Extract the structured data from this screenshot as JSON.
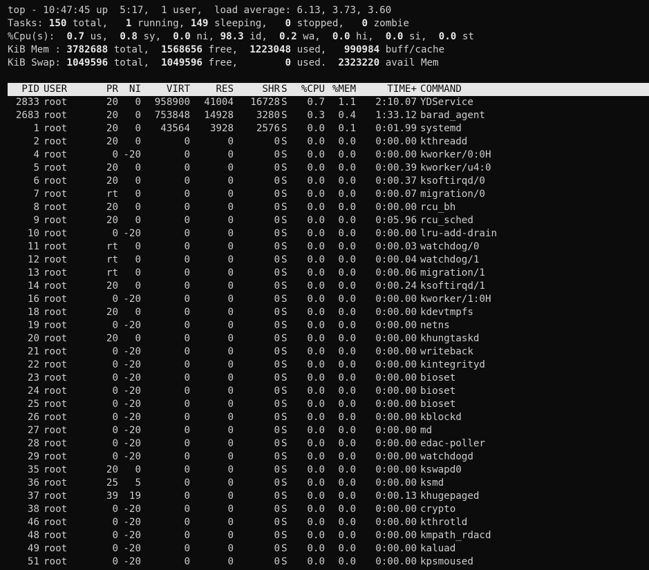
{
  "summary": {
    "line1": "top - 10:47:45 up  5:17,  1 user,  load average: 6.13, 3.73, 3.60",
    "tasks": {
      "label": "Tasks:",
      "total": "150",
      "total_l": " total,",
      "running": "1",
      "running_l": " running,",
      "sleeping": "149",
      "sleeping_l": " sleeping,",
      "stopped": "0",
      "stopped_l": " stopped,",
      "zombie": "0",
      "zombie_l": " zombie"
    },
    "cpu": {
      "label": "%Cpu(s):",
      "us": "0.7",
      "us_l": " us,",
      "sy": "0.8",
      "sy_l": " sy,",
      "ni": "0.0",
      "ni_l": " ni,",
      "id": "98.3",
      "id_l": " id,",
      "wa": "0.2",
      "wa_l": " wa,",
      "hi": "0.0",
      "hi_l": " hi,",
      "si": "0.0",
      "si_l": " si,",
      "st": "0.0",
      "st_l": " st"
    },
    "mem": {
      "label": "KiB Mem :",
      "total": "3782688",
      "total_l": " total,",
      "free": "1568656",
      "free_l": " free,",
      "used": "1223048",
      "used_l": " used,",
      "buff": "990984",
      "buff_l": " buff/cache"
    },
    "swap": {
      "label": "KiB Swap:",
      "total": "1049596",
      "total_l": " total,",
      "free": "1049596",
      "free_l": " free,",
      "used": "0",
      "used_l": " used.",
      "avail": "2323220",
      "avail_l": " avail Mem"
    }
  },
  "columns": [
    "PID",
    "USER",
    "PR",
    "NI",
    "VIRT",
    "RES",
    "SHR",
    "S",
    "%CPU",
    "%MEM",
    "TIME+",
    "COMMAND"
  ],
  "processes": [
    [
      "2833",
      "root",
      "20",
      "0",
      "958900",
      "41004",
      "16728",
      "S",
      "0.7",
      "1.1",
      "2:10.07",
      "YDService"
    ],
    [
      "2683",
      "root",
      "20",
      "0",
      "753848",
      "14928",
      "3280",
      "S",
      "0.3",
      "0.4",
      "1:33.12",
      "barad_agent"
    ],
    [
      "1",
      "root",
      "20",
      "0",
      "43564",
      "3928",
      "2576",
      "S",
      "0.0",
      "0.1",
      "0:01.99",
      "systemd"
    ],
    [
      "2",
      "root",
      "20",
      "0",
      "0",
      "0",
      "0",
      "S",
      "0.0",
      "0.0",
      "0:00.00",
      "kthreadd"
    ],
    [
      "4",
      "root",
      "0",
      "-20",
      "0",
      "0",
      "0",
      "S",
      "0.0",
      "0.0",
      "0:00.00",
      "kworker/0:0H"
    ],
    [
      "5",
      "root",
      "20",
      "0",
      "0",
      "0",
      "0",
      "S",
      "0.0",
      "0.0",
      "0:00.39",
      "kworker/u4:0"
    ],
    [
      "6",
      "root",
      "20",
      "0",
      "0",
      "0",
      "0",
      "S",
      "0.0",
      "0.0",
      "0:00.37",
      "ksoftirqd/0"
    ],
    [
      "7",
      "root",
      "rt",
      "0",
      "0",
      "0",
      "0",
      "S",
      "0.0",
      "0.0",
      "0:00.07",
      "migration/0"
    ],
    [
      "8",
      "root",
      "20",
      "0",
      "0",
      "0",
      "0",
      "S",
      "0.0",
      "0.0",
      "0:00.00",
      "rcu_bh"
    ],
    [
      "9",
      "root",
      "20",
      "0",
      "0",
      "0",
      "0",
      "S",
      "0.0",
      "0.0",
      "0:05.96",
      "rcu_sched"
    ],
    [
      "10",
      "root",
      "0",
      "-20",
      "0",
      "0",
      "0",
      "S",
      "0.0",
      "0.0",
      "0:00.00",
      "lru-add-drain"
    ],
    [
      "11",
      "root",
      "rt",
      "0",
      "0",
      "0",
      "0",
      "S",
      "0.0",
      "0.0",
      "0:00.03",
      "watchdog/0"
    ],
    [
      "12",
      "root",
      "rt",
      "0",
      "0",
      "0",
      "0",
      "S",
      "0.0",
      "0.0",
      "0:00.04",
      "watchdog/1"
    ],
    [
      "13",
      "root",
      "rt",
      "0",
      "0",
      "0",
      "0",
      "S",
      "0.0",
      "0.0",
      "0:00.06",
      "migration/1"
    ],
    [
      "14",
      "root",
      "20",
      "0",
      "0",
      "0",
      "0",
      "S",
      "0.0",
      "0.0",
      "0:00.24",
      "ksoftirqd/1"
    ],
    [
      "16",
      "root",
      "0",
      "-20",
      "0",
      "0",
      "0",
      "S",
      "0.0",
      "0.0",
      "0:00.00",
      "kworker/1:0H"
    ],
    [
      "18",
      "root",
      "20",
      "0",
      "0",
      "0",
      "0",
      "S",
      "0.0",
      "0.0",
      "0:00.00",
      "kdevtmpfs"
    ],
    [
      "19",
      "root",
      "0",
      "-20",
      "0",
      "0",
      "0",
      "S",
      "0.0",
      "0.0",
      "0:00.00",
      "netns"
    ],
    [
      "20",
      "root",
      "20",
      "0",
      "0",
      "0",
      "0",
      "S",
      "0.0",
      "0.0",
      "0:00.00",
      "khungtaskd"
    ],
    [
      "21",
      "root",
      "0",
      "-20",
      "0",
      "0",
      "0",
      "S",
      "0.0",
      "0.0",
      "0:00.00",
      "writeback"
    ],
    [
      "22",
      "root",
      "0",
      "-20",
      "0",
      "0",
      "0",
      "S",
      "0.0",
      "0.0",
      "0:00.00",
      "kintegrityd"
    ],
    [
      "23",
      "root",
      "0",
      "-20",
      "0",
      "0",
      "0",
      "S",
      "0.0",
      "0.0",
      "0:00.00",
      "bioset"
    ],
    [
      "24",
      "root",
      "0",
      "-20",
      "0",
      "0",
      "0",
      "S",
      "0.0",
      "0.0",
      "0:00.00",
      "bioset"
    ],
    [
      "25",
      "root",
      "0",
      "-20",
      "0",
      "0",
      "0",
      "S",
      "0.0",
      "0.0",
      "0:00.00",
      "bioset"
    ],
    [
      "26",
      "root",
      "0",
      "-20",
      "0",
      "0",
      "0",
      "S",
      "0.0",
      "0.0",
      "0:00.00",
      "kblockd"
    ],
    [
      "27",
      "root",
      "0",
      "-20",
      "0",
      "0",
      "0",
      "S",
      "0.0",
      "0.0",
      "0:00.00",
      "md"
    ],
    [
      "28",
      "root",
      "0",
      "-20",
      "0",
      "0",
      "0",
      "S",
      "0.0",
      "0.0",
      "0:00.00",
      "edac-poller"
    ],
    [
      "29",
      "root",
      "0",
      "-20",
      "0",
      "0",
      "0",
      "S",
      "0.0",
      "0.0",
      "0:00.00",
      "watchdogd"
    ],
    [
      "35",
      "root",
      "20",
      "0",
      "0",
      "0",
      "0",
      "S",
      "0.0",
      "0.0",
      "0:00.00",
      "kswapd0"
    ],
    [
      "36",
      "root",
      "25",
      "5",
      "0",
      "0",
      "0",
      "S",
      "0.0",
      "0.0",
      "0:00.00",
      "ksmd"
    ],
    [
      "37",
      "root",
      "39",
      "19",
      "0",
      "0",
      "0",
      "S",
      "0.0",
      "0.0",
      "0:00.13",
      "khugepaged"
    ],
    [
      "38",
      "root",
      "0",
      "-20",
      "0",
      "0",
      "0",
      "S",
      "0.0",
      "0.0",
      "0:00.00",
      "crypto"
    ],
    [
      "46",
      "root",
      "0",
      "-20",
      "0",
      "0",
      "0",
      "S",
      "0.0",
      "0.0",
      "0:00.00",
      "kthrotld"
    ],
    [
      "48",
      "root",
      "0",
      "-20",
      "0",
      "0",
      "0",
      "S",
      "0.0",
      "0.0",
      "0:00.00",
      "kmpath_rdacd"
    ],
    [
      "49",
      "root",
      "0",
      "-20",
      "0",
      "0",
      "0",
      "S",
      "0.0",
      "0.0",
      "0:00.00",
      "kaluad"
    ],
    [
      "51",
      "root",
      "0",
      "-20",
      "0",
      "0",
      "0",
      "S",
      "0.0",
      "0.0",
      "0:00.00",
      "kpsmoused"
    ]
  ]
}
